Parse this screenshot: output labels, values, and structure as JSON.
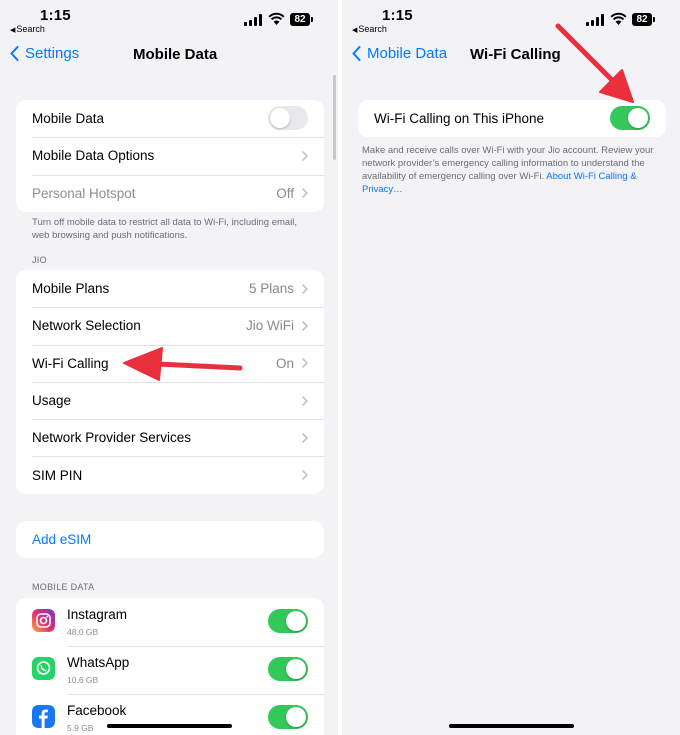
{
  "status": {
    "time": "1:15",
    "back_app": "Search",
    "battery": "82"
  },
  "left": {
    "nav": {
      "back_label": "Settings",
      "title": "Mobile Data"
    },
    "main_group": [
      {
        "label": "Mobile Data",
        "value": "",
        "toggle": "off"
      },
      {
        "label": "Mobile Data Options",
        "value": ""
      },
      {
        "label": "Personal Hotspot",
        "value": "Off",
        "disabled": true
      }
    ],
    "main_footnote": "Turn off mobile data to restrict all data to Wi-Fi, including email, web browsing and push notifications.",
    "jio_header": "JIO",
    "jio_group": [
      {
        "label": "Mobile Plans",
        "value": "5 Plans"
      },
      {
        "label": "Network Selection",
        "value": "Jio WiFi"
      },
      {
        "label": "Wi-Fi Calling",
        "value": "On"
      },
      {
        "label": "Usage",
        "value": ""
      },
      {
        "label": "Network Provider Services",
        "value": ""
      },
      {
        "label": "SIM PIN",
        "value": ""
      }
    ],
    "add_esim": "Add eSIM",
    "mobile_data_header": "MOBILE DATA",
    "apps": [
      {
        "name": "Instagram",
        "size": "48.0 GB",
        "toggle": "on",
        "icon": "instagram-icon"
      },
      {
        "name": "WhatsApp",
        "size": "10.6 GB",
        "toggle": "on",
        "icon": "whatsapp-icon"
      },
      {
        "name": "Facebook",
        "size": "5.9 GB",
        "toggle": "on",
        "icon": "facebook-icon"
      }
    ]
  },
  "right": {
    "nav": {
      "back_label": "Mobile Data",
      "title": "Wi-Fi Calling"
    },
    "wifi_calling_label": "Wi-Fi Calling on This iPhone",
    "wifi_calling_toggle": "on",
    "footnote": "Make and receive calls over Wi-Fi with your Jio account. Review your network provider’s emergency calling information to understand the availability of emergency calling over Wi-Fi.",
    "footnote_link": "About Wi-Fi Calling & Privacy…"
  },
  "colors": {
    "accent": "#007aff",
    "toggle_on": "#34c759",
    "annotation_arrow": "#ea2f3d",
    "background": "#f2f2f7"
  }
}
